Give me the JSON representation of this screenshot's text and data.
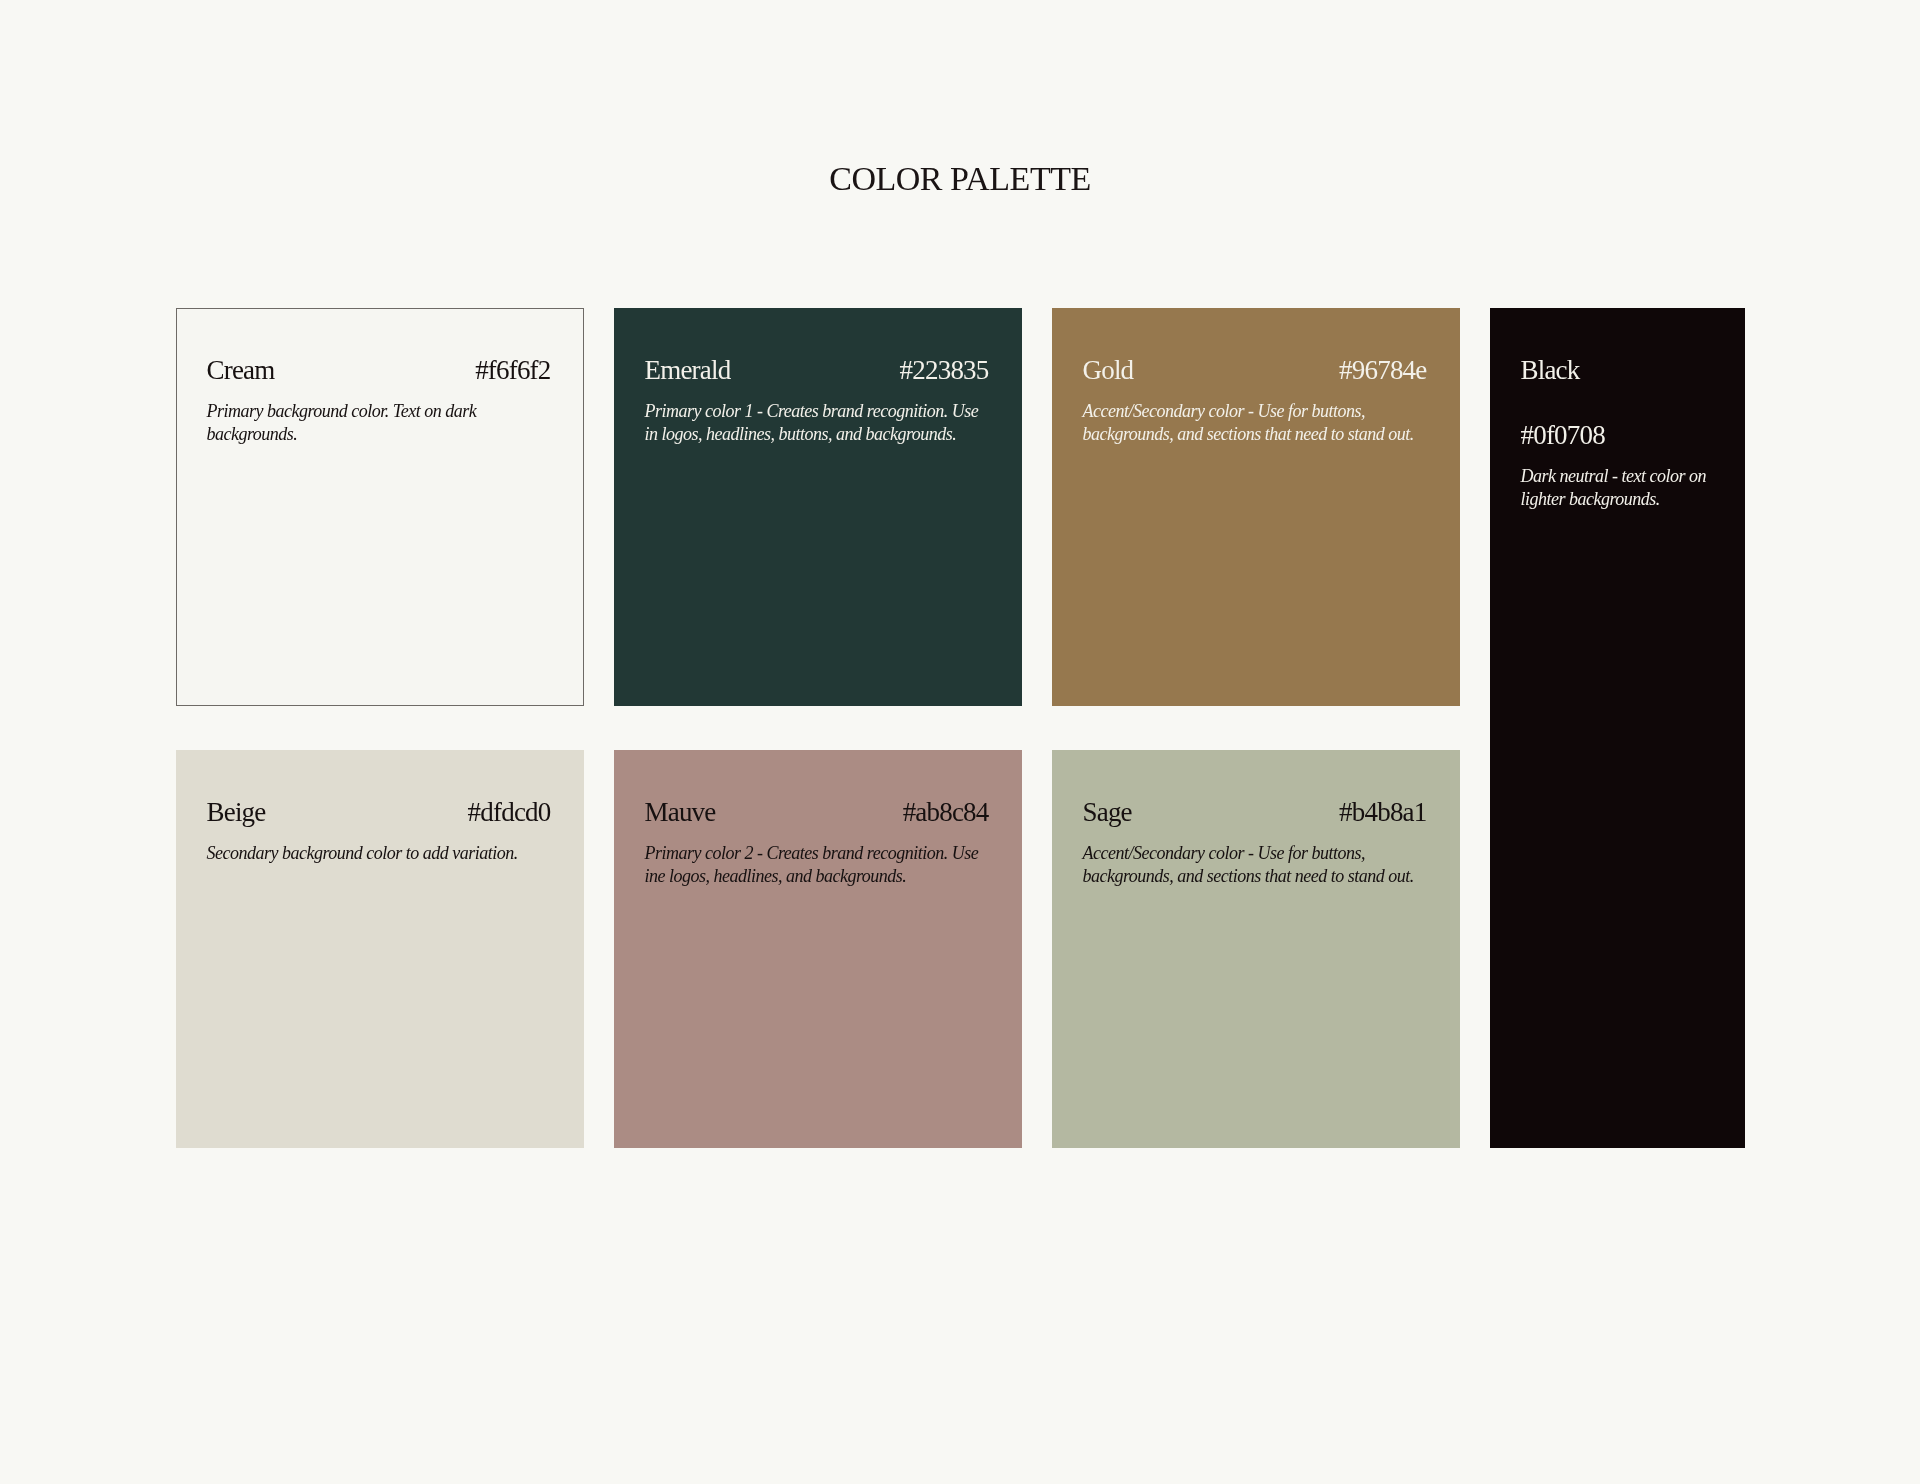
{
  "title": "COLOR PALETTE",
  "swatches": [
    {
      "kind": "square",
      "name": "Cream",
      "hex": "#f6f6f2",
      "color": "#f6f6f2",
      "description": "Primary background color. Text on dark backgrounds."
    },
    {
      "kind": "square",
      "name": "Emerald",
      "hex": "#223835",
      "color": "#223835",
      "description": "Primary color 1 - Creates brand recognition. Use in logos, headlines, buttons, and backgrounds."
    },
    {
      "kind": "square",
      "name": "Gold",
      "hex": "#96784e",
      "color": "#96784e",
      "description": "Accent/Secondary color - Use for buttons, backgrounds, and sections that need to stand out."
    },
    {
      "kind": "tall",
      "name": "Black",
      "hex": "#0f0708",
      "color": "#0f0708",
      "description": "Dark neutral - text color on lighter backgrounds."
    },
    {
      "kind": "square",
      "name": "Beige",
      "hex": "#dfdcd0",
      "color": "#dfdcd0",
      "description": "Secondary background color to add variation."
    },
    {
      "kind": "square",
      "name": "Mauve",
      "hex": "#ab8c84",
      "color": "#ab8c84",
      "description": "Primary color 2 - Creates brand recognition. Use ine logos, headlines, and backgrounds."
    },
    {
      "kind": "square",
      "name": "Sage",
      "hex": "#b4b8a1",
      "color": "#b4b8a1",
      "description": "Accent/Secondary color - Use for buttons, backgrounds, and sections that need to stand out."
    }
  ]
}
